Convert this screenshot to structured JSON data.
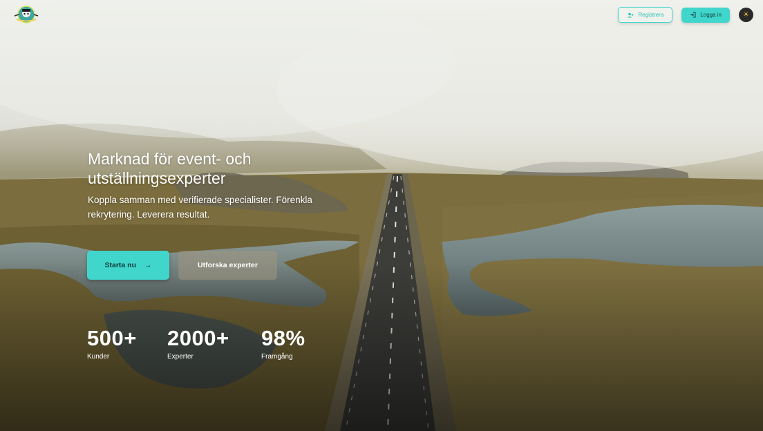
{
  "header": {
    "logo_icon": "mascot-logo-icon",
    "register_label": "Registrera",
    "register_icon": "user-plus-icon",
    "login_label": "Logga in",
    "login_icon": "login-arrow-icon",
    "theme_icon": "sun-icon"
  },
  "hero": {
    "title": "Marknad för event- och utställningsexperter",
    "subtitle": "Koppla samman med verifierade specialister. Förenkla rekrytering. Leverera resultat.",
    "primary_cta": "Starta nu",
    "primary_cta_icon": "arrow-right-icon",
    "secondary_cta": "Utforska experter"
  },
  "stats": [
    {
      "value": "500+",
      "label": "Kunder"
    },
    {
      "value": "2000+",
      "label": "Experter"
    },
    {
      "value": "98%",
      "label": "Framgång"
    }
  ],
  "colors": {
    "accent": "#41d6cc",
    "accent_text": "#0f3b38"
  }
}
